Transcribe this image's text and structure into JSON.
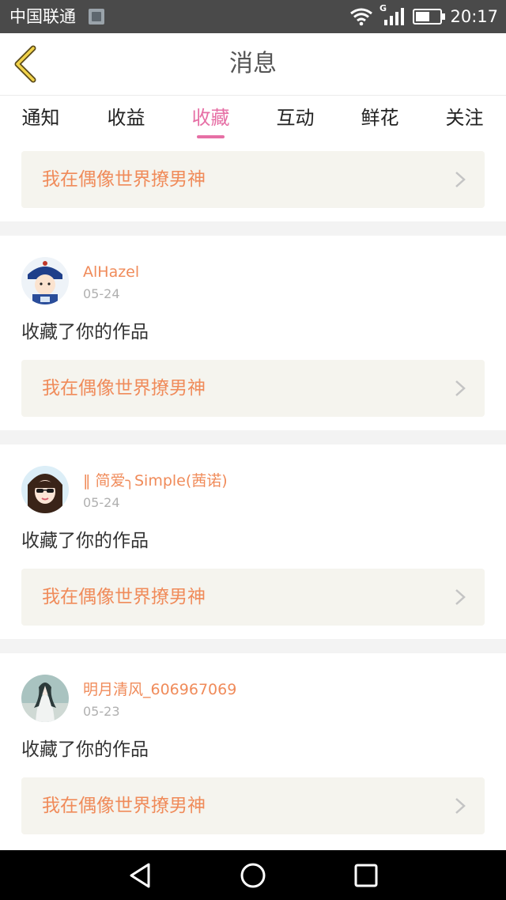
{
  "status_bar": {
    "carrier": "中国联通",
    "network": "G",
    "time": "20:17"
  },
  "header": {
    "title": "消息"
  },
  "tabs": [
    {
      "label": "通知",
      "active": false
    },
    {
      "label": "收益",
      "active": false
    },
    {
      "label": "收藏",
      "active": true
    },
    {
      "label": "互动",
      "active": false
    },
    {
      "label": "鲜花",
      "active": false
    },
    {
      "label": "关注",
      "active": false
    }
  ],
  "colors": {
    "accent": "#e66fa5",
    "orange": "#f08b5a",
    "card_bg": "#f5f4ee",
    "gap_bg": "#f3f3f3"
  },
  "top_card": {
    "work_title": "我在偶像世界撩男神"
  },
  "messages": [
    {
      "user": "AlHazel",
      "date": "05-24",
      "text": "收藏了你的作品",
      "work_title": "我在偶像世界撩男神",
      "avatar": "avatar-qing-official"
    },
    {
      "user": "‖ 简爱╮Simple(茜诺)",
      "date": "05-24",
      "text": "收藏了你的作品",
      "work_title": "我在偶像世界撩男神",
      "avatar": "avatar-girl-sunglasses"
    },
    {
      "user": "明月清风_606967069",
      "date": "05-23",
      "text": "收藏了你的作品",
      "work_title": "我在偶像世界撩男神",
      "avatar": "avatar-ancient-lady"
    }
  ]
}
